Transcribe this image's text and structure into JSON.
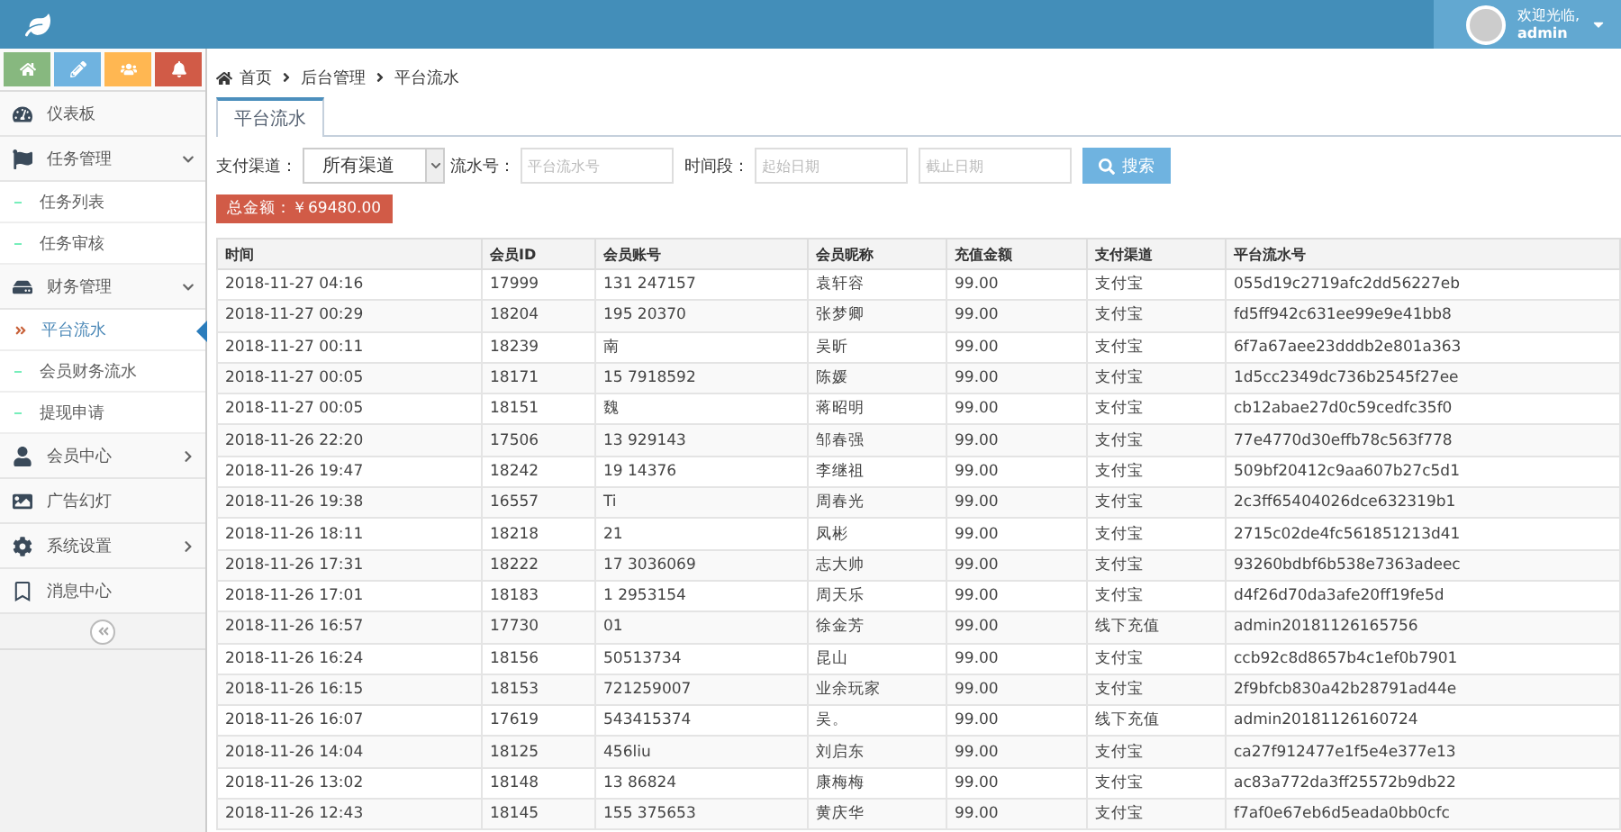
{
  "header": {
    "welcome": "欢迎光临,",
    "user": "admin"
  },
  "shortcuts": [
    {
      "color": "#87b87f"
    },
    {
      "color": "#6fb3e0"
    },
    {
      "color": "#ffb752"
    },
    {
      "color": "#d15b47"
    }
  ],
  "sidebar": {
    "items": [
      {
        "label": "仪表板",
        "selected": false
      },
      {
        "label": "任务管理",
        "selected": false,
        "expanded": true,
        "children": [
          {
            "label": "任务列表",
            "selected": false
          },
          {
            "label": "任务审核",
            "selected": false
          }
        ]
      },
      {
        "label": "财务管理",
        "selected": false,
        "expanded": true,
        "children": [
          {
            "label": "平台流水",
            "selected": true
          },
          {
            "label": "会员财务流水",
            "selected": false
          },
          {
            "label": "提现申请",
            "selected": false
          }
        ]
      },
      {
        "label": "会员中心",
        "selected": false,
        "expanded": false
      },
      {
        "label": "广告幻灯",
        "selected": false
      },
      {
        "label": "系统设置",
        "selected": false,
        "expanded": false
      },
      {
        "label": "消息中心",
        "selected": false
      }
    ]
  },
  "breadcrumb": [
    "首页",
    "后台管理",
    "平台流水"
  ],
  "tabs": [
    {
      "label": "平台流水",
      "selected": true
    }
  ],
  "filters": {
    "channel_label": "支付渠道：",
    "channel_value": "所有渠道",
    "serial_label": "流水号：",
    "serial_placeholder": "平台流水号",
    "period_label": "时间段：",
    "start_placeholder": "起始日期",
    "end_placeholder": "截止日期",
    "search_button": "搜索"
  },
  "total": "总金额：￥69480.00",
  "table": {
    "columns": [
      "时间",
      "会员ID",
      "会员账号",
      "会员昵称",
      "充值金额",
      "支付渠道",
      "平台流水号"
    ],
    "rows": [
      [
        "2018-11-27 04:16",
        "17999",
        "131 247157",
        "袁轩容",
        "99.00",
        "支付宝",
        "055d19c2719afc2dd56227eb"
      ],
      [
        "2018-11-27 00:29",
        "18204",
        "195 20370",
        "张梦卿",
        "99.00",
        "支付宝",
        "fd5ff942c631ee99e9e41bb8"
      ],
      [
        "2018-11-27 00:11",
        "18239",
        "南",
        "吴昕",
        "99.00",
        "支付宝",
        "6f7a67aee23dddb2e801a363"
      ],
      [
        "2018-11-27 00:05",
        "18171",
        "15 7918592",
        "陈媛",
        "99.00",
        "支付宝",
        "1d5cc2349dc736b2545f27ee"
      ],
      [
        "2018-11-27 00:05",
        "18151",
        "魏",
        "蒋昭明",
        "99.00",
        "支付宝",
        "cb12abae27d0c59cedfc35f0"
      ],
      [
        "2018-11-26 22:20",
        "17506",
        "13 929143",
        "邹春强",
        "99.00",
        "支付宝",
        "77e4770d30effb78c563f778"
      ],
      [
        "2018-11-26 19:47",
        "18242",
        "19 14376",
        "李继祖",
        "99.00",
        "支付宝",
        "509bf20412c9aa607b27c5d1"
      ],
      [
        "2018-11-26 19:38",
        "16557",
        "Ti",
        "周春光",
        "99.00",
        "支付宝",
        "2c3ff65404026dce632319b1"
      ],
      [
        "2018-11-26 18:11",
        "18218",
        "21",
        "凤彬",
        "99.00",
        "支付宝",
        "2715c02de4fc561851213d41"
      ],
      [
        "2018-11-26 17:31",
        "18222",
        "17 3036069",
        "志大帅",
        "99.00",
        "支付宝",
        "93260bdbf6b538e7363adeec"
      ],
      [
        "2018-11-26 17:01",
        "18183",
        "1 2953154",
        "周天乐",
        "99.00",
        "支付宝",
        "d4f26d70da3afe20ff19fe5d"
      ],
      [
        "2018-11-26 16:57",
        "17730",
        "01",
        "徐金芳",
        "99.00",
        "线下充值",
        "admin20181126165756"
      ],
      [
        "2018-11-26 16:24",
        "18156",
        "50513734",
        "昆山",
        "99.00",
        "支付宝",
        "ccb92c8d8657b4c1ef0b7901"
      ],
      [
        "2018-11-26 16:15",
        "18153",
        "721259007",
        "业余玩家",
        "99.00",
        "支付宝",
        "2f9bfcb830a42b28791ad44e"
      ],
      [
        "2018-11-26 16:07",
        "17619",
        "543415374",
        "吴。",
        "99.00",
        "线下充值",
        "admin20181126160724"
      ],
      [
        "2018-11-26 14:04",
        "18125",
        "456liu",
        "刘启东",
        "99.00",
        "支付宝",
        "ca27f912477e1f5e4e377e13"
      ],
      [
        "2018-11-26 13:02",
        "18148",
        "13 86824",
        "康梅梅",
        "99.00",
        "支付宝",
        "ac83a772da3ff25572b9db22"
      ],
      [
        "2018-11-26 12:43",
        "18145",
        "155 375653",
        "黄庆华",
        "99.00",
        "支付宝",
        "f7af0e67eb6d5eada0bb0cfc"
      ]
    ]
  }
}
